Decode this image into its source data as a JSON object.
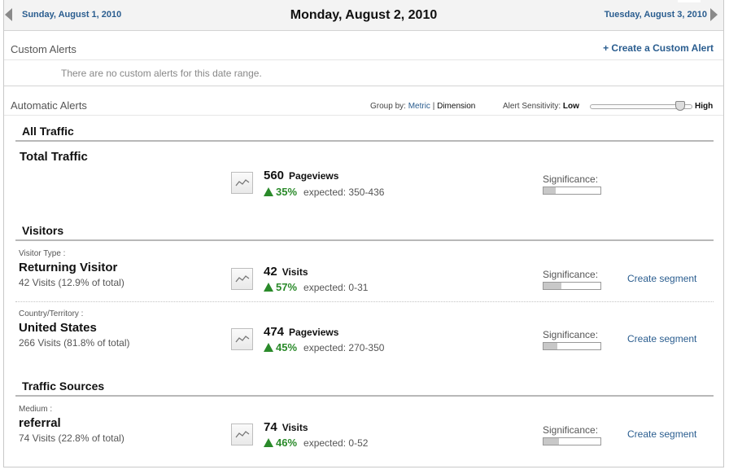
{
  "datebar": {
    "prev_label": "Sunday, August 1, 2010",
    "title": "Monday, August 2, 2010",
    "next_label": "Tuesday, August 3, 2010"
  },
  "custom_alerts": {
    "title": "Custom Alerts",
    "create_link": "+ Create a Custom Alert",
    "empty_message": "There are no custom alerts for this date range."
  },
  "automatic_alerts": {
    "title": "Automatic Alerts",
    "group_by_label": "Group by:",
    "group_by_metric": "Metric",
    "group_by_separator": "|",
    "group_by_dimension": "Dimension",
    "sensitivity_label": "Alert Sensitivity:",
    "sensitivity_low": "Low",
    "sensitivity_high": "High",
    "sensitivity_level": 0.92
  },
  "groups": [
    {
      "title": "All Traffic",
      "rows": [
        {
          "dimension_name": "",
          "dimension_value": "Total Traffic",
          "dimension_sub": "",
          "metric_value": "560",
          "metric_name": "Pageviews",
          "change": "35%",
          "expected": "expected: 350-436",
          "significance_label": "Significance:",
          "significance": 0.22,
          "segment_link": ""
        }
      ]
    },
    {
      "title": "Visitors",
      "rows": [
        {
          "dimension_name": "Visitor Type :",
          "dimension_value": "Returning Visitor",
          "dimension_sub": "42 Visits (12.9% of total)",
          "metric_value": "42",
          "metric_name": "Visits",
          "change": "57%",
          "expected": "expected: 0-31",
          "significance_label": "Significance:",
          "significance": 0.32,
          "segment_link": "Create segment"
        },
        {
          "dimension_name": "Country/Territory :",
          "dimension_value": "United States",
          "dimension_sub": "266 Visits (81.8% of total)",
          "metric_value": "474",
          "metric_name": "Pageviews",
          "change": "45%",
          "expected": "expected: 270-350",
          "significance_label": "Significance:",
          "significance": 0.24,
          "segment_link": "Create segment"
        }
      ]
    },
    {
      "title": "Traffic Sources",
      "rows": [
        {
          "dimension_name": "Medium :",
          "dimension_value": "referral",
          "dimension_sub": "74 Visits (22.8% of total)",
          "metric_value": "74",
          "metric_name": "Visits",
          "change": "46%",
          "expected": "expected: 0-52",
          "significance_label": "Significance:",
          "significance": 0.27,
          "segment_link": "Create segment"
        }
      ]
    }
  ],
  "icons": {
    "prev": "triangle-left-icon",
    "next": "triangle-right-icon",
    "sparkline": "sparkline-chart-icon",
    "change_up": "triangle-up-icon"
  },
  "colors": {
    "link": "#2a5d8f",
    "increase": "#2a8a2a"
  }
}
